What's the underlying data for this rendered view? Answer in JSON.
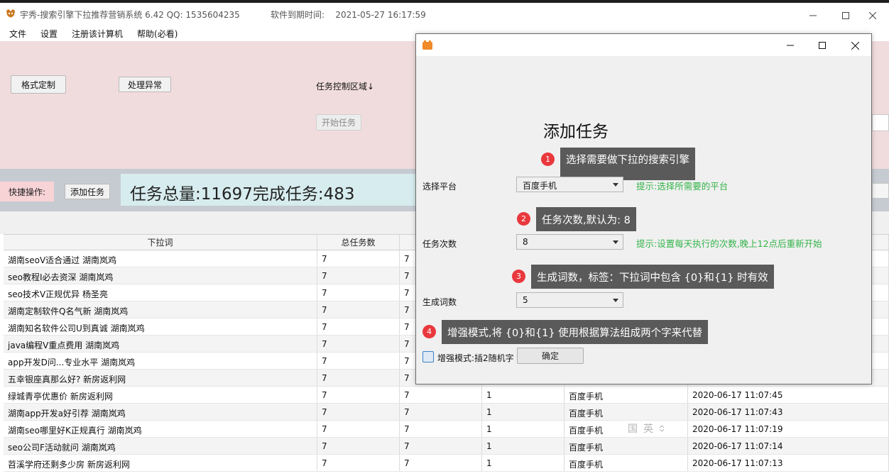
{
  "window": {
    "title": "宇秀-搜索引擎下拉推荐营销系统 6.42   QQ: 1535604235",
    "expire_label": "软件到期时间:",
    "expire_value": "2021-05-27 16:17:59"
  },
  "menu": [
    "文件",
    "设置",
    "注册该计算机",
    "帮助(必看)"
  ],
  "top_panel": {
    "format_btn": "格式定制",
    "error_btn": "处理异常",
    "task_control_label": "任务控制区域↓",
    "start_btn": "开始任务"
  },
  "quick_bar": {
    "label": "快捷操作:",
    "add_task_btn": "添加任务",
    "stats": "任务总量:11697完成任务:483"
  },
  "table": {
    "headers": [
      "下拉词",
      "总任务数",
      "",
      "",
      "",
      ""
    ],
    "rows": [
      [
        "湖南seoV适合通过 湖南岚鸡",
        "7",
        "7",
        "",
        "",
        ""
      ],
      [
        "seo教程I必去资深 湖南岚鸡",
        "7",
        "7",
        "",
        "",
        ""
      ],
      [
        "seo技术V正规优异 杨圣亮",
        "7",
        "7",
        "",
        "",
        ""
      ],
      [
        "湖南定制软件Q名气新 湖南岚鸡",
        "7",
        "7",
        "",
        "",
        ""
      ],
      [
        "湖南知名软件公司U到真诚 湖南岚鸡",
        "7",
        "7",
        "",
        "",
        ""
      ],
      [
        "java编程V重点费用 湖南岚鸡",
        "7",
        "7",
        "",
        "",
        ""
      ],
      [
        "app开发D问...专业水平 湖南岚鸡",
        "7",
        "7",
        "",
        "",
        ""
      ],
      [
        "五幸银座真那么好? 新房返利网",
        "7",
        "7",
        "",
        "",
        ""
      ],
      [
        "绿城青亭优惠价 新房返利网",
        "7",
        "7",
        "1",
        "百度手机",
        "2020-06-17 11:07:45"
      ],
      [
        "湖南app开发a好引荐 湖南岚鸡",
        "7",
        "7",
        "1",
        "百度手机",
        "2020-06-17 11:07:43"
      ],
      [
        "湖南seo哪里好K正规真行 湖南岚鸡",
        "7",
        "7",
        "1",
        "百度手机",
        "2020-06-17 11:07:19"
      ],
      [
        "seo公司F活动就问 湖南岚鸡",
        "7",
        "7",
        "1",
        "百度手机",
        "2020-06-17 11:07:14"
      ],
      [
        "苕溪学府还剩多少房 新房返利网",
        "7",
        "7",
        "1",
        "百度手机",
        "2020-06-17 11:07:13"
      ]
    ]
  },
  "ime": {
    "left": "国",
    "right": "英"
  },
  "dialog": {
    "heading": "添加任务",
    "platform_label": "选择平台",
    "platform_value": "百度手机",
    "platform_hint": "提示:选择所需要的平台",
    "count_label": "任务次数",
    "count_value": "8",
    "count_hint": "提示:设置每天执行的次数,晚上12点后重新开始",
    "words_label": "生成词数",
    "words_value": "5",
    "enhance_label": "增强模式:插2随机字",
    "ok_btn": "确定",
    "callouts": [
      {
        "num": "1",
        "text": "选择需要做下拉的搜索引擎"
      },
      {
        "num": "2",
        "text": "任务次数,默认为: 8"
      },
      {
        "num": "3",
        "text": "生成词数，标签：下拉词中包含 {0}和{1} 时有效"
      },
      {
        "num": "4",
        "text": "增强模式,将 {0}和{1} 使用根据算法组成两个字来代替"
      }
    ]
  },
  "colors": {
    "top_panel": "#f1dcdd",
    "quick_bar": "#c6cbd2",
    "stats_bg": "#d7ecee",
    "callout_bg": "#5a5a5a",
    "callout_num": "#e9383d",
    "hint": "#34b34a"
  }
}
